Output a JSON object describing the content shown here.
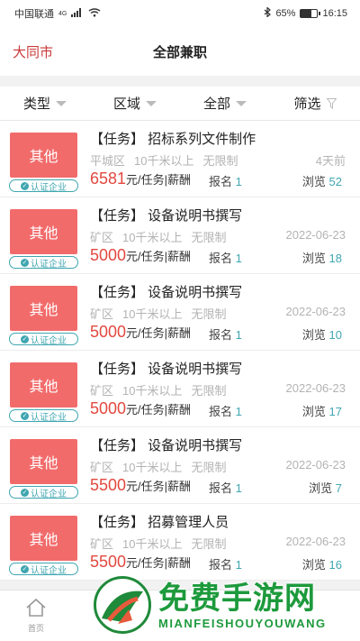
{
  "status_bar": {
    "carrier": "中国联通",
    "network": "4G",
    "battery": "65%",
    "time": "16:15"
  },
  "header": {
    "city": "大同市",
    "title": "全部兼职"
  },
  "filters": [
    {
      "label": "类型"
    },
    {
      "label": "区域"
    },
    {
      "label": "全部"
    },
    {
      "label": "筛选"
    }
  ],
  "jobs": [
    {
      "thumb": "其他",
      "cert": "认证企业",
      "title": "【任务】 招标系列文件制作",
      "district": "平城区",
      "distance": "10千米以上",
      "limit": "无限制",
      "date": "4天前",
      "price": "6581",
      "unit": "元/任务|薪酬",
      "signup_label": "报名",
      "signup": "1",
      "views_label": "浏览",
      "views": "52"
    },
    {
      "thumb": "其他",
      "cert": "认证企业",
      "title": "【任务】 设备说明书撰写",
      "district": "矿区",
      "distance": "10千米以上",
      "limit": "无限制",
      "date": "2022-06-23",
      "price": "5000",
      "unit": "元/任务|薪酬",
      "signup_label": "报名",
      "signup": "1",
      "views_label": "浏览",
      "views": "18"
    },
    {
      "thumb": "其他",
      "cert": "认证企业",
      "title": "【任务】 设备说明书撰写",
      "district": "矿区",
      "distance": "10千米以上",
      "limit": "无限制",
      "date": "2022-06-23",
      "price": "5000",
      "unit": "元/任务|薪酬",
      "signup_label": "报名",
      "signup": "1",
      "views_label": "浏览",
      "views": "10"
    },
    {
      "thumb": "其他",
      "cert": "认证企业",
      "title": "【任务】 设备说明书撰写",
      "district": "矿区",
      "distance": "10千米以上",
      "limit": "无限制",
      "date": "2022-06-23",
      "price": "5000",
      "unit": "元/任务|薪酬",
      "signup_label": "报名",
      "signup": "1",
      "views_label": "浏览",
      "views": "17"
    },
    {
      "thumb": "其他",
      "cert": "认证企业",
      "title": "【任务】 设备说明书撰写",
      "district": "矿区",
      "distance": "10千米以上",
      "limit": "无限制",
      "date": "2022-06-23",
      "price": "5500",
      "unit": "元/任务|薪酬",
      "signup_label": "报名",
      "signup": "1",
      "views_label": "浏览",
      "views": "7"
    },
    {
      "thumb": "其他",
      "cert": "认证企业",
      "title": "【任务】 招募管理人员",
      "district": "矿区",
      "distance": "10千米以上",
      "limit": "无限制",
      "date": "2022-06-23",
      "price": "5500",
      "unit": "元/任务|薪酬",
      "signup_label": "报名",
      "signup": "1",
      "views_label": "浏览",
      "views": "16"
    }
  ],
  "tabbar": {
    "home_label": "首页"
  },
  "watermark": {
    "title": "免费手游网",
    "subtitle": "MIANFEISHOUYOUWANG"
  },
  "colors": {
    "accent": "#c9393a",
    "thumb": "#f26b6b",
    "price": "#e2483f",
    "teal": "#3fa6b0",
    "watermark": "#1d9a3c"
  }
}
